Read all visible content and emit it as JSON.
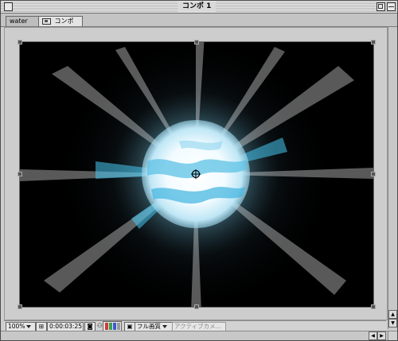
{
  "window": {
    "title": "コンポ 1"
  },
  "tabs": [
    {
      "label": "water"
    },
    {
      "label": "コンポ 1"
    }
  ],
  "viewer": {
    "content": "light-burst-glow"
  },
  "toolbar": {
    "zoom": "100%",
    "timecode": "0:00:03:25",
    "quality": "フル画質",
    "camera": "アクティブカメ..."
  },
  "icons": {
    "close": "close-box-icon",
    "zoom": "zoom-box-icon",
    "collapse": "collapse-box-icon",
    "comp": "composition-icon",
    "lock": "lock-icon",
    "snapshot": "camera-icon",
    "channels": "rgb-channel-icon",
    "region": "region-of-interest-icon",
    "safe": "title-safe-icon"
  },
  "colors": {
    "glow_core": "#ffffff",
    "glow_cyan": "#47c7f0",
    "background": "#000000"
  }
}
